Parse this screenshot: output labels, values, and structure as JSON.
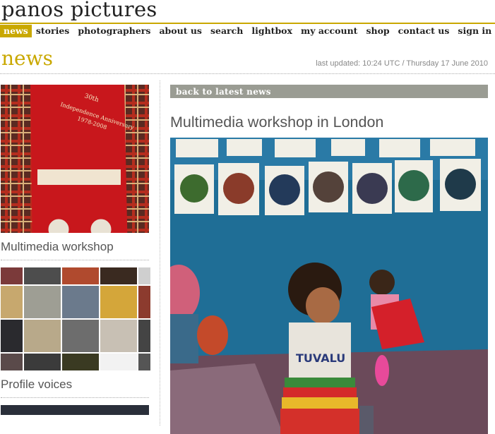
{
  "site": {
    "title": "panos pictures"
  },
  "nav": {
    "items": [
      {
        "label": "news",
        "active": true
      },
      {
        "label": "stories"
      },
      {
        "label": "photographers"
      },
      {
        "label": "about us"
      },
      {
        "label": "search"
      },
      {
        "label": "lightbox"
      },
      {
        "label": "my account"
      },
      {
        "label": "shop"
      },
      {
        "label": "contact us"
      },
      {
        "label": "sign in"
      }
    ]
  },
  "page": {
    "heading": "news",
    "last_updated": "last updated: 10:24 UTC / Thursday 17 June 2010"
  },
  "sidebar": {
    "items": [
      {
        "caption": "Multimedia workshop",
        "image": "fabric-photo"
      },
      {
        "caption": "Profile voices",
        "image": "photo-mosaic"
      }
    ]
  },
  "main": {
    "back_label": "back to latest news",
    "title": "Multimedia workshop in London",
    "photo": "children-classroom-photo"
  },
  "colors": {
    "accent": "#c9a800",
    "bar": "#9a9c93"
  }
}
